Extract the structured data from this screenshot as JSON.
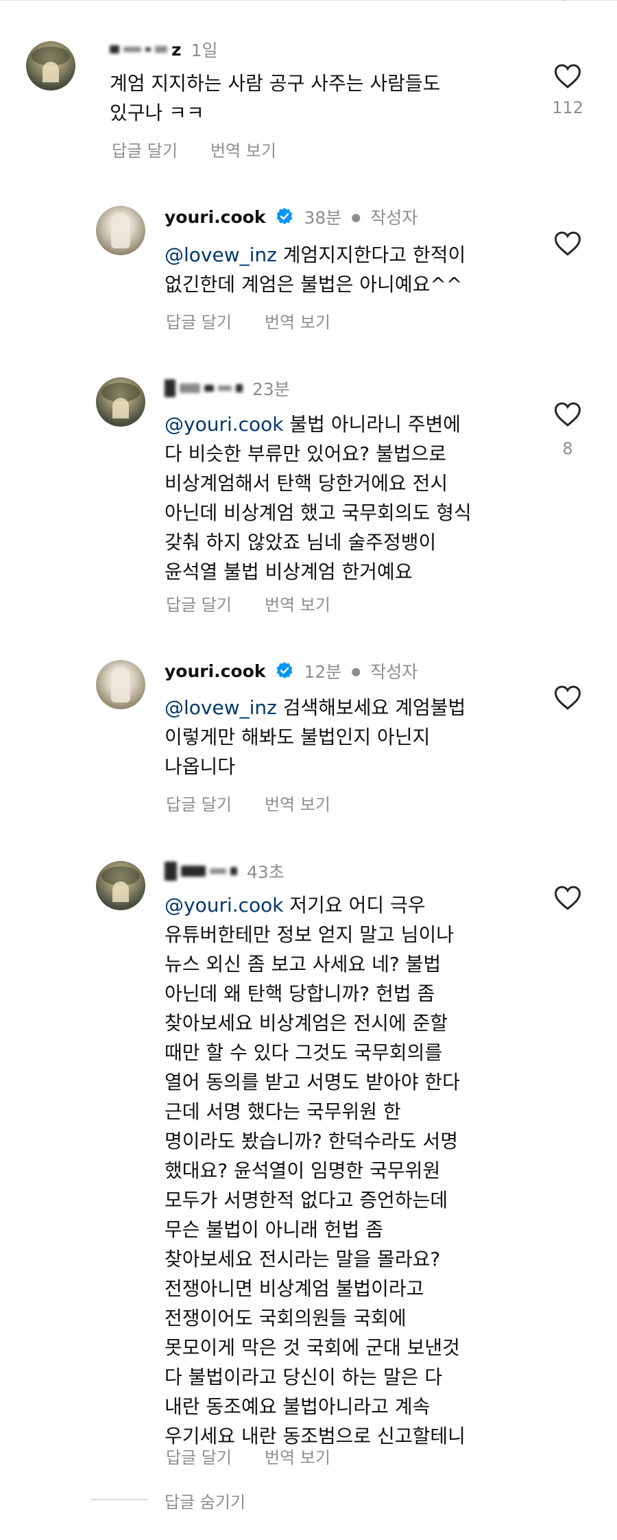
{
  "common": {
    "reply_label": "답글 달기",
    "translate_label": "번역 보기",
    "author_label": "작성자"
  },
  "comments": [
    {
      "username": "z",
      "time": "1일",
      "body_lines": [
        "계엄 지지하는 사람 공구 사주는 사람들도",
        "있구나 ㅋㅋ"
      ],
      "likes": "112"
    },
    {
      "username": "youri.cook",
      "time": "38분",
      "mention": "@lovew_inz",
      "body_lines": [
        " 계엄지지한다고 한적이",
        "없긴한데 계엄은 불법은 아니예요^^"
      ],
      "likes": ""
    },
    {
      "username": "",
      "time": "23분",
      "mention": "@youri.cook",
      "body_lines": [
        " 불법 아니라니 주변에",
        "다 비슷한 부류만 있어요? 불법으로",
        "비상계엄해서 탄핵 당한거에요 전시",
        "아닌데 비상계엄 했고 국무회의도 형식",
        "갖춰 하지 않았죠 님네 술주정뱅이",
        "윤석열 불법 비상계엄 한거예요"
      ],
      "likes": "8"
    },
    {
      "username": "youri.cook",
      "time": "12분",
      "mention": "@lovew_inz",
      "body_lines": [
        " 검색해보세요 계엄불법",
        "이렇게만 해봐도 불법인지 아닌지",
        "나옵니다"
      ],
      "likes": ""
    },
    {
      "username": "",
      "time": "43초",
      "mention": "@youri.cook",
      "body_lines": [
        " 저기요 어디 극우",
        "유튜버한테만 정보 얻지 말고 님이나",
        "뉴스 외신 좀 보고 사세요 네? 불법",
        "아닌데 왜 탄핵 당합니까? 헌법 좀",
        "찾아보세요 비상계엄은 전시에 준할",
        "때만 할 수 있다 그것도 국무회의를",
        "열어 동의를 받고 서명도 받아야 한다",
        "근데 서명 했다는 국무위원 한",
        "명이라도 봤습니까? 한덕수라도 서명",
        "했대요? 윤석열이 임명한 국무위원",
        "모두가 서명한적 없다고 증언하는데",
        "무슨 불법이 아니래 헌법 좀",
        "찾아보세요 전시라는 말을 몰라요?",
        "전쟁아니면 비상계엄 불법이라고",
        "전쟁이어도 국회의원들 국회에",
        "못모이게 막은 것 국회에 군대 보낸것",
        "다 불법이라고 당신이 하는 말은 다",
        "내란 동조예요 불법아니라고 계속",
        "우기세요 내란 동조범으로 신고할테니"
      ],
      "likes": ""
    }
  ],
  "footer": {
    "hide_replies": "답글 숨기기"
  }
}
